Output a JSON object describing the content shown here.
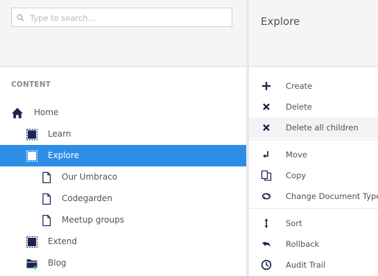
{
  "search": {
    "placeholder": "Type to search..."
  },
  "tree": {
    "heading": "CONTENT",
    "items": [
      {
        "label": "Home",
        "icon": "home-icon"
      },
      {
        "label": "Learn",
        "icon": "section-icon"
      },
      {
        "label": "Explore",
        "icon": "section-icon",
        "selected": true
      },
      {
        "label": "Our Umbraco",
        "icon": "document-icon"
      },
      {
        "label": "Codegarden",
        "icon": "document-icon"
      },
      {
        "label": "Meetup groups",
        "icon": "document-icon"
      },
      {
        "label": "Extend",
        "icon": "section-icon"
      },
      {
        "label": "Blog",
        "icon": "folder-icon"
      }
    ]
  },
  "actions": {
    "title": "Explore",
    "items": [
      {
        "label": "Create",
        "icon": "plus-icon"
      },
      {
        "label": "Delete",
        "icon": "delete-icon"
      },
      {
        "label": "Delete all children",
        "icon": "delete-icon",
        "highlighted": true
      },
      {
        "label": "Move",
        "icon": "move-icon"
      },
      {
        "label": "Copy",
        "icon": "copy-icon"
      },
      {
        "label": "Change Document Type",
        "icon": "change-type-icon"
      },
      {
        "label": "Sort",
        "icon": "sort-icon"
      },
      {
        "label": "Rollback",
        "icon": "undo-icon"
      },
      {
        "label": "Audit Trail",
        "icon": "clock-icon"
      }
    ]
  },
  "colors": {
    "selected_bg": "#2e8ee6",
    "folder_accent": "#2bc37c",
    "text": "#515054"
  }
}
